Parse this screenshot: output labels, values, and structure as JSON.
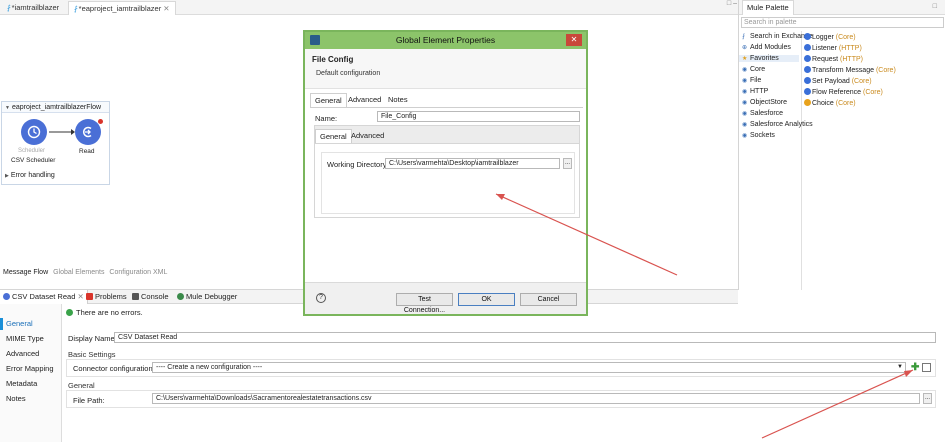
{
  "editor_tabs": [
    {
      "label": "*iamtrailblazer"
    },
    {
      "label": "*eaproject_iamtrailblazer"
    }
  ],
  "flow": {
    "title": "eaproject_iamtrailblazerFlow",
    "scheduler_small": "Scheduler",
    "scheduler_label": "CSV Scheduler",
    "read_label": "Read",
    "error_handling": "Error handling"
  },
  "canvas_tabs": [
    "Message Flow",
    "Global Elements",
    "Configuration XML"
  ],
  "panel_tabs": [
    "CSV Dataset Read",
    "Problems",
    "Console",
    "Mule Debugger"
  ],
  "side_nav": [
    "General",
    "MIME Type",
    "Advanced",
    "Error Mapping",
    "Metadata",
    "Notes"
  ],
  "status": "There are no errors.",
  "form": {
    "display_name_label": "Display Name:",
    "display_name_value": "CSV Dataset Read",
    "basic_settings": "Basic Settings",
    "connector_config_label": "Connector configuration:",
    "connector_config_value": "---- Create a new configuration ----",
    "general_group": "General",
    "file_path_label": "File Path:",
    "file_path_value": "C:\\Users\\varmehta\\Downloads\\Sacramentorealestatetransactions.csv",
    "browse": "..."
  },
  "palette": {
    "title": "Mule Palette",
    "search_placeholder": "Search in palette",
    "categories": [
      "Search in Exchange",
      "Add Modules",
      "Favorites",
      "Core",
      "File",
      "HTTP",
      "ObjectStore",
      "Salesforce",
      "Salesforce Analytics",
      "Sockets"
    ],
    "items": [
      {
        "name": "Logger",
        "group": "(Core)",
        "color": "#3a6fd8"
      },
      {
        "name": "Listener",
        "group": "(HTTP)",
        "color": "#3a6fd8"
      },
      {
        "name": "Request",
        "group": "(HTTP)",
        "color": "#3a6fd8"
      },
      {
        "name": "Transform Message",
        "group": "(Core)",
        "color": "#3a6fd8"
      },
      {
        "name": "Set Payload",
        "group": "(Core)",
        "color": "#3a6fd8"
      },
      {
        "name": "Flow Reference",
        "group": "(Core)",
        "color": "#3a6fd8"
      },
      {
        "name": "Choice",
        "group": "(Core)",
        "color": "#e8a21c"
      }
    ]
  },
  "dialog": {
    "title": "Global Element Properties",
    "header_title": "File Config",
    "header_sub": "Default configuration",
    "tabs": [
      "General",
      "Advanced",
      "Notes"
    ],
    "name_label": "Name:",
    "name_value": "File_Config",
    "inner_tabs": [
      "General",
      "Advanced"
    ],
    "working_dir_label": "Working Directory:",
    "working_dir_value": "C:\\Users\\varmehta\\Desktop\\iamtrailblazer",
    "browse": "...",
    "help": "?",
    "test_connection": "Test Connection...",
    "ok": "OK",
    "cancel": "Cancel"
  },
  "colors": {
    "accent": "#1a8fd8",
    "dialog_border": "#7ab55c",
    "arrow": "#d9534f"
  }
}
